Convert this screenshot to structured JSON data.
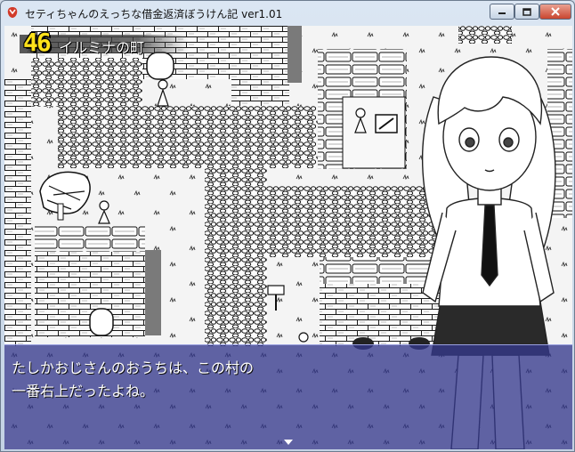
{
  "window": {
    "title": "セティちゃんのえっちな借金返済ぼうけん記 ver1.01",
    "controls": {
      "minimize": "minimize",
      "maximize": "maximize",
      "close": "close"
    }
  },
  "hud": {
    "location_number": "46",
    "location_name": "イルミナの町"
  },
  "message": {
    "line1": "たしかおじさんのおうちは、この村の",
    "line2": "一番右上だったよね。"
  },
  "colors": {
    "title_bar": "#c3d2e4",
    "close_button": "#c9452f",
    "message_window": "#34388c",
    "location_number": "#ffe21a"
  },
  "icons": [
    "app-icon",
    "minimize-icon",
    "maximize-icon",
    "close-icon",
    "next-page-cursor-icon"
  ]
}
